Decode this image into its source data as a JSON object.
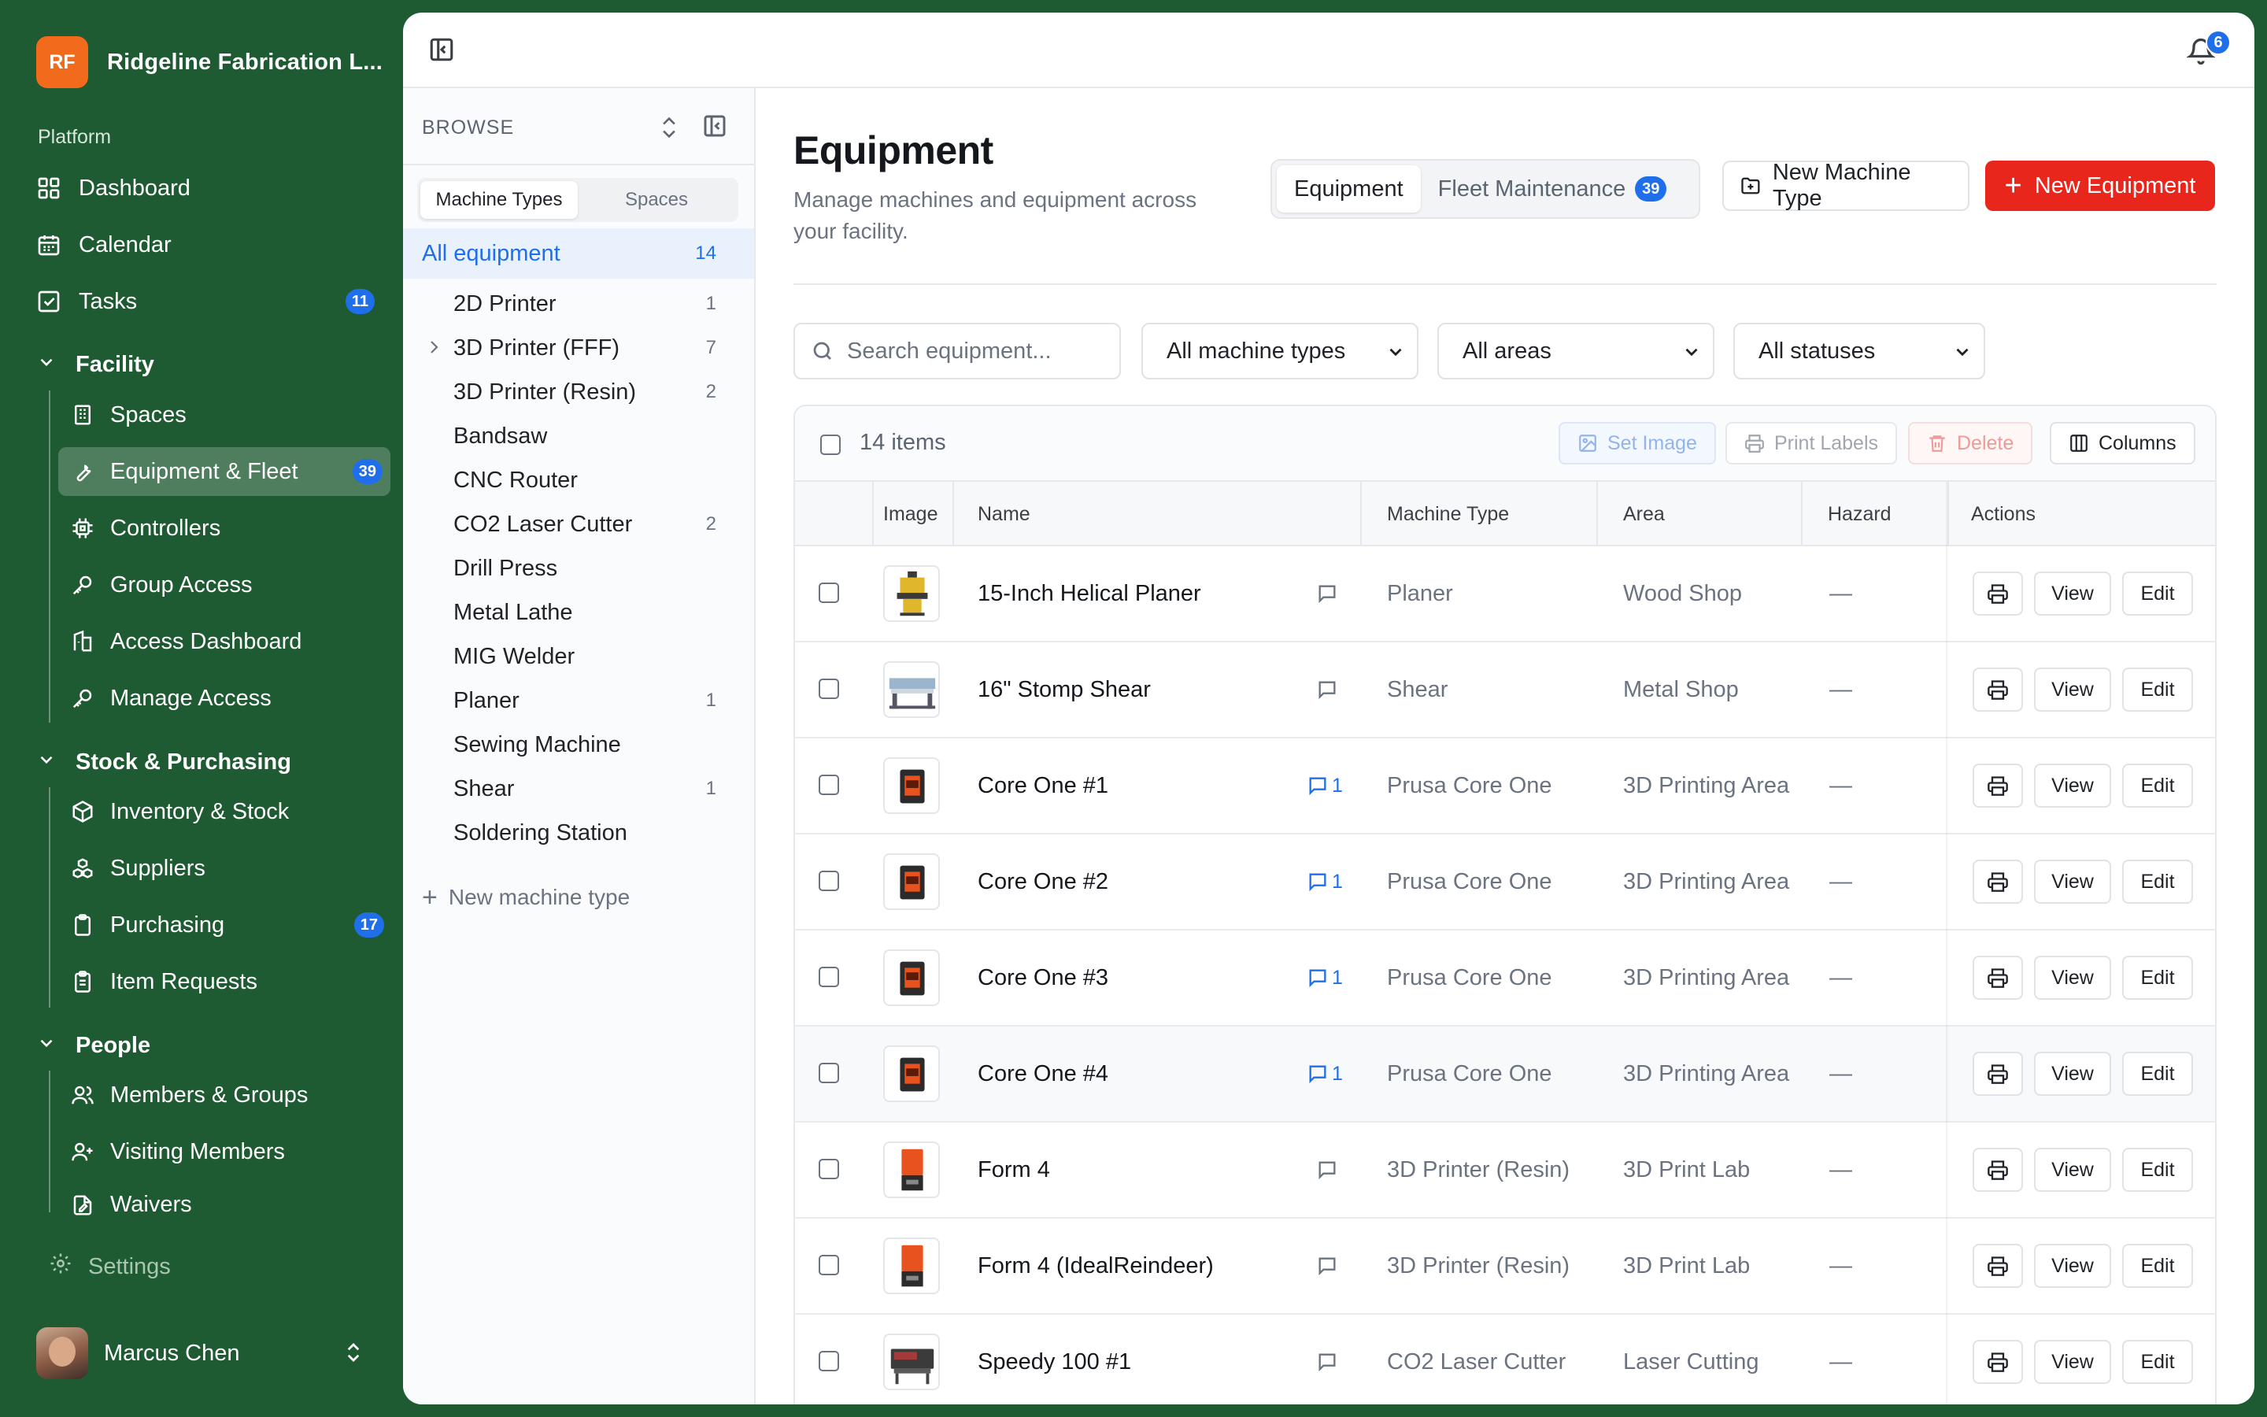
{
  "brand": {
    "initials": "RF",
    "name": "Ridgeline Fabrication L...",
    "logo_color": "#f26b1d"
  },
  "sidebar": {
    "section_label": "Platform",
    "top_items": [
      {
        "label": "Dashboard",
        "icon": "grid-icon"
      },
      {
        "label": "Calendar",
        "icon": "calendar-icon"
      },
      {
        "label": "Tasks",
        "icon": "checkbox-icon",
        "badge": "11"
      }
    ],
    "groups": [
      {
        "label": "Facility",
        "items": [
          {
            "label": "Spaces",
            "icon": "building-icon"
          },
          {
            "label": "Equipment & Fleet",
            "icon": "wrench-icon",
            "badge": "39",
            "active": true
          },
          {
            "label": "Controllers",
            "icon": "chip-icon"
          },
          {
            "label": "Group Access",
            "icon": "key-icon"
          },
          {
            "label": "Access Dashboard",
            "icon": "gate-icon"
          },
          {
            "label": "Manage Access",
            "icon": "key-icon"
          }
        ]
      },
      {
        "label": "Stock & Purchasing",
        "items": [
          {
            "label": "Inventory & Stock",
            "icon": "box-icon"
          },
          {
            "label": "Suppliers",
            "icon": "boxes-icon"
          },
          {
            "label": "Purchasing",
            "icon": "clipboard-icon",
            "badge": "17"
          },
          {
            "label": "Item Requests",
            "icon": "clipboard-list-icon"
          }
        ]
      },
      {
        "label": "People",
        "items": [
          {
            "label": "Members & Groups",
            "icon": "users-icon"
          },
          {
            "label": "Visiting Members",
            "icon": "user-plus-icon"
          },
          {
            "label": "Waivers",
            "icon": "document-pen-icon"
          }
        ]
      }
    ],
    "settings_label": "Settings",
    "user_name": "Marcus Chen"
  },
  "topbar": {
    "notification_count": "6"
  },
  "browse": {
    "header": "BROWSE",
    "tabs": [
      "Machine Types",
      "Spaces"
    ],
    "all_label": "All equipment",
    "all_count": "14",
    "types": [
      {
        "label": "2D Printer",
        "count": "1"
      },
      {
        "label": "3D Printer (FFF)",
        "count": "7",
        "expandable": true
      },
      {
        "label": "3D Printer (Resin)",
        "count": "2"
      },
      {
        "label": "Bandsaw",
        "count": ""
      },
      {
        "label": "CNC Router",
        "count": ""
      },
      {
        "label": "CO2 Laser Cutter",
        "count": "2"
      },
      {
        "label": "Drill Press",
        "count": ""
      },
      {
        "label": "Metal Lathe",
        "count": ""
      },
      {
        "label": "MIG Welder",
        "count": ""
      },
      {
        "label": "Planer",
        "count": "1"
      },
      {
        "label": "Sewing Machine",
        "count": ""
      },
      {
        "label": "Shear",
        "count": "1"
      },
      {
        "label": "Soldering Station",
        "count": ""
      }
    ],
    "new_type_label": "New machine type"
  },
  "page": {
    "title": "Equipment",
    "subtitle": "Manage machines and equipment across your facility.",
    "view_tabs": {
      "equipment": "Equipment",
      "fleet": "Fleet Maintenance",
      "fleet_badge": "39"
    },
    "new_machine_type": "New Machine Type",
    "new_equipment": "New Equipment"
  },
  "filters": {
    "search_placeholder": "Search equipment...",
    "machine_types": "All machine types",
    "areas": "All areas",
    "statuses": "All statuses"
  },
  "table": {
    "count_label": "14 items",
    "bulk": {
      "set_image": "Set Image",
      "print_labels": "Print Labels",
      "delete": "Delete",
      "columns": "Columns"
    },
    "columns": [
      "Image",
      "Name",
      "Machine Type",
      "Area",
      "Hazard",
      "Actions"
    ],
    "view_label": "View",
    "edit_label": "Edit",
    "rows": [
      {
        "name": "15-Inch Helical Planer",
        "comments": "",
        "type": "Planer",
        "area": "Wood Shop",
        "hazard": "—",
        "thumb": "planer"
      },
      {
        "name": "16\" Stomp Shear",
        "comments": "",
        "type": "Shear",
        "area": "Metal Shop",
        "hazard": "—",
        "thumb": "shear"
      },
      {
        "name": "Core One #1",
        "comments": "1",
        "type": "Prusa Core One",
        "area": "3D Printing Area",
        "hazard": "—",
        "thumb": "prusa"
      },
      {
        "name": "Core One #2",
        "comments": "1",
        "type": "Prusa Core One",
        "area": "3D Printing Area",
        "hazard": "—",
        "thumb": "prusa"
      },
      {
        "name": "Core One #3",
        "comments": "1",
        "type": "Prusa Core One",
        "area": "3D Printing Area",
        "hazard": "—",
        "thumb": "prusa"
      },
      {
        "name": "Core One #4",
        "comments": "1",
        "type": "Prusa Core One",
        "area": "3D Printing Area",
        "hazard": "—",
        "thumb": "prusa",
        "hover": true
      },
      {
        "name": "Form 4",
        "comments": "",
        "type": "3D Printer (Resin)",
        "area": "3D Print Lab",
        "hazard": "—",
        "thumb": "form"
      },
      {
        "name": "Form 4 (IdealReindeer)",
        "comments": "",
        "type": "3D Printer (Resin)",
        "area": "3D Print Lab",
        "hazard": "—",
        "thumb": "form"
      },
      {
        "name": "Speedy 100 #1",
        "comments": "",
        "type": "CO2 Laser Cutter",
        "area": "Laser Cutting",
        "hazard": "—",
        "thumb": "laser"
      }
    ]
  }
}
